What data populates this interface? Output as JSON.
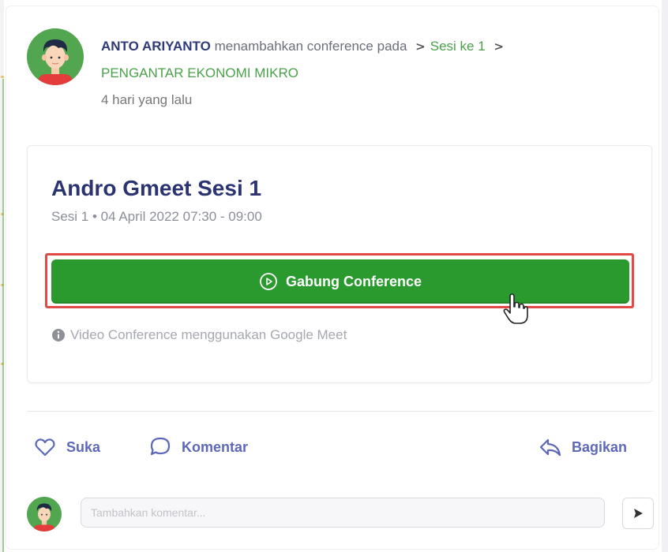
{
  "post": {
    "author": "ANTO ARIYANTO",
    "action_text": "menambahkan conference pada",
    "breadcrumb": [
      "Sesi ke 1",
      "PENGANTAR EKONOMI MIKRO"
    ],
    "time_ago": "4 hari yang lalu"
  },
  "conference": {
    "title": "Andro Gmeet Sesi 1",
    "subtitle": "Sesi 1 • 04 April 2022 07:30 - 09:00",
    "join_label": "Gabung Conference",
    "info": "Video Conference menggunakan Google Meet"
  },
  "actions": {
    "like": "Suka",
    "comment": "Komentar",
    "share": "Bagikan"
  },
  "comment_box": {
    "placeholder": "Tambahkan komentar...",
    "value": ""
  },
  "colors": {
    "brand_green": "#2a9a2e",
    "link_green": "#4aa14a",
    "title_navy": "#2b3370",
    "action_blue": "#5d68b8",
    "highlight_red": "#e24a4a"
  },
  "icons": [
    "avatar",
    "chevron-right-icon",
    "play-circle-icon",
    "pointer-cursor-icon",
    "info-icon",
    "heart-icon",
    "comment-icon",
    "share-icon",
    "send-icon"
  ]
}
